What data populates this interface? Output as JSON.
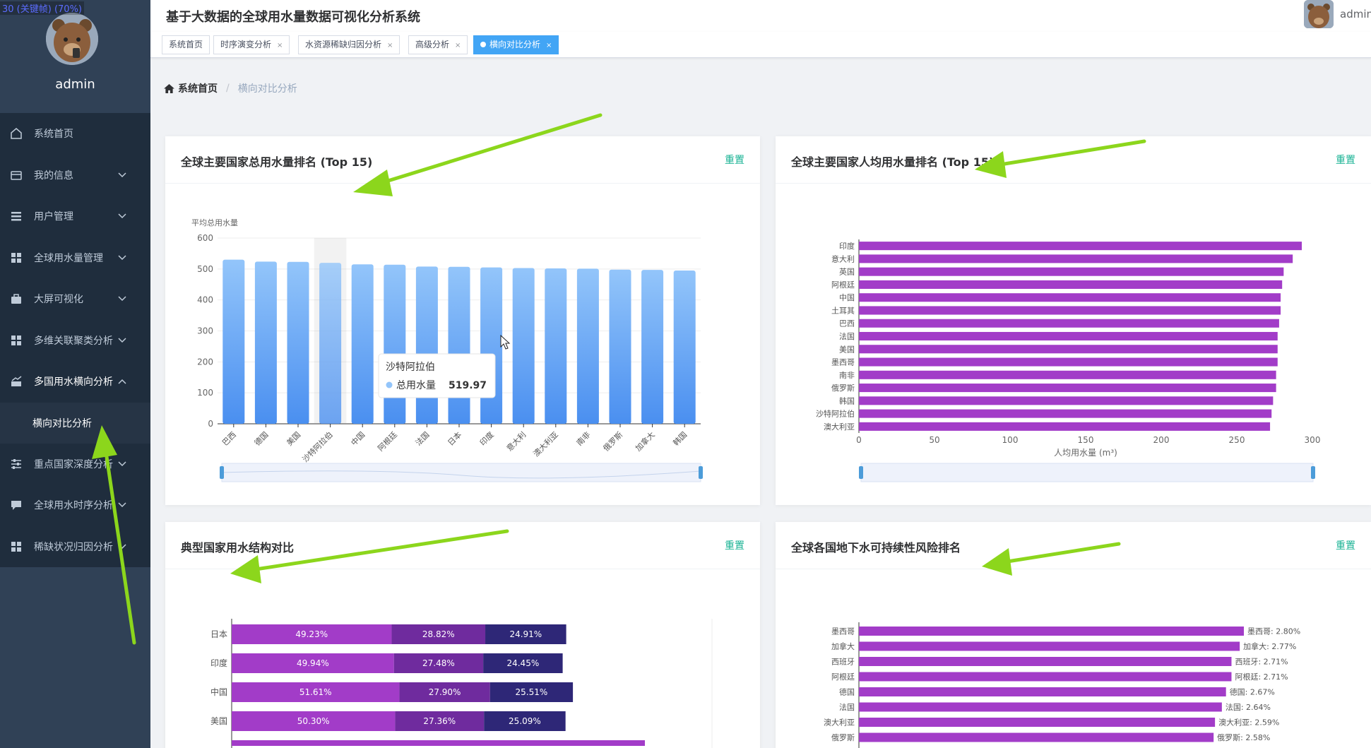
{
  "overlay": {
    "fps_text": "30 (关键帧) (70%)"
  },
  "sidebar": {
    "username": "admin",
    "items": [
      {
        "label": "系统首页",
        "icon": "home-icon",
        "has_chevron": false
      },
      {
        "label": "我的信息",
        "icon": "card-icon",
        "has_chevron": true
      },
      {
        "label": "用户管理",
        "icon": "list-icon",
        "has_chevron": true
      },
      {
        "label": "全球用水量管理",
        "icon": "grid-icon",
        "has_chevron": true
      },
      {
        "label": "大屏可视化",
        "icon": "briefcase-icon",
        "has_chevron": true
      },
      {
        "label": "多维关联聚类分析",
        "icon": "grid-icon",
        "has_chevron": true
      },
      {
        "label": "多国用水横向分析",
        "icon": "chart-icon",
        "has_chevron": true,
        "expanded": true
      },
      {
        "label": "重点国家深度分析",
        "icon": "sliders-icon",
        "has_chevron": true
      },
      {
        "label": "全球用水时序分析",
        "icon": "comment-icon",
        "has_chevron": true
      },
      {
        "label": "稀缺状况归因分析",
        "icon": "grid-icon",
        "has_chevron": true
      }
    ],
    "active_sub": "横向对比分析"
  },
  "header": {
    "title": "基于大数据的全球用水量数据可视化分析系统",
    "username": "admin"
  },
  "tags": [
    {
      "label": "系统首页",
      "closable": false,
      "active": false
    },
    {
      "label": "时序演变分析",
      "closable": true,
      "active": false
    },
    {
      "label": "水资源稀缺归因分析",
      "closable": true,
      "active": false
    },
    {
      "label": "高级分析",
      "closable": true,
      "active": false
    },
    {
      "label": "横向对比分析",
      "closable": true,
      "active": true
    }
  ],
  "breadcrumb": {
    "home": "系统首页",
    "current": "横向对比分析"
  },
  "colors": {
    "sidebar_bg": "#304156",
    "menu_bg": "#1f2d3d",
    "tag_active": "#42a5f5",
    "bar_blue": "#5599f0",
    "bar_purple": "#a23cc8",
    "reset_green": "#1ab394"
  },
  "cards": {
    "total_use": {
      "title": "全球主要国家总用水量排名 (Top 15)",
      "reset": "重置"
    },
    "per_capita": {
      "title": "全球主要国家人均用水量排名 (Top 15)",
      "reset": "重置"
    },
    "structure": {
      "title": "典型国家用水结构对比",
      "reset": "重置"
    },
    "groundwater": {
      "title": "全球各国地下水可持续性风险排名",
      "reset": "重置"
    }
  },
  "chart_data": [
    {
      "type": "bar",
      "title": "全球主要国家总用水量排名 (Top 15)",
      "ylabel": "平均总用水量",
      "ylim": [
        0,
        600
      ],
      "yticks": [
        0,
        100,
        200,
        300,
        400,
        500,
        600
      ],
      "categories": [
        "巴西",
        "德国",
        "美国",
        "沙特阿拉伯",
        "中国",
        "阿根廷",
        "法国",
        "日本",
        "印度",
        "意大利",
        "澳大利亚",
        "南非",
        "俄罗斯",
        "加拿大",
        "韩国"
      ],
      "values": [
        530,
        524,
        523,
        519.97,
        515,
        514,
        508,
        507,
        505,
        503,
        502,
        501,
        498,
        497,
        495
      ],
      "tooltip": {
        "category": "沙特阿拉伯",
        "series": "总用水量",
        "value": "519.97"
      },
      "grid": true,
      "datazoom": true
    },
    {
      "type": "bar",
      "orientation": "horizontal",
      "title": "全球主要国家人均用水量排名 (Top 15)",
      "xlabel": "人均用水量 (m³)",
      "xlim": [
        0,
        300
      ],
      "xticks": [
        0,
        50,
        100,
        150,
        200,
        250,
        300
      ],
      "categories": [
        "印度",
        "意大利",
        "英国",
        "阿根廷",
        "中国",
        "土耳其",
        "巴西",
        "法国",
        "美国",
        "墨西哥",
        "南非",
        "俄罗斯",
        "韩国",
        "沙特阿拉伯",
        "澳大利亚"
      ],
      "values": [
        293,
        287,
        281,
        280,
        279,
        279,
        278,
        277,
        277,
        277,
        276,
        276,
        274,
        273,
        272
      ],
      "datazoom": true
    },
    {
      "type": "bar",
      "orientation": "horizontal",
      "stacked": true,
      "title": "典型国家用水结构对比",
      "categories": [
        "日本",
        "印度",
        "中国",
        "美国"
      ],
      "series": [
        {
          "values": [
            49.23,
            49.94,
            51.61,
            50.3
          ],
          "labels": [
            "49.23%",
            "49.94%",
            "51.61%",
            "50.30%"
          ],
          "color": "#a23cc8"
        },
        {
          "values": [
            28.82,
            27.48,
            27.9,
            27.36
          ],
          "labels": [
            "28.82%",
            "27.48%",
            "27.90%",
            "27.36%"
          ],
          "color": "#6f2b9e"
        },
        {
          "values": [
            24.91,
            24.45,
            25.51,
            25.09
          ],
          "labels": [
            "24.91%",
            "24.45%",
            "25.51%",
            "25.09%"
          ],
          "color": "#2e2777"
        }
      ]
    },
    {
      "type": "bar",
      "orientation": "horizontal",
      "title": "全球各国地下水可持续性风险排名",
      "categories": [
        "墨西哥",
        "加拿大",
        "西班牙",
        "阿根廷",
        "德国",
        "法国",
        "澳大利亚",
        "俄罗斯"
      ],
      "values": [
        2.8,
        2.77,
        2.71,
        2.71,
        2.67,
        2.64,
        2.59,
        2.58
      ],
      "labels": [
        "墨西哥: 2.80%",
        "加拿大: 2.77%",
        "西班牙: 2.71%",
        "阿根廷: 2.71%",
        "德国: 2.67%",
        "法国: 2.64%",
        "澳大利亚: 2.59%",
        "俄罗斯: 2.58%"
      ]
    }
  ]
}
